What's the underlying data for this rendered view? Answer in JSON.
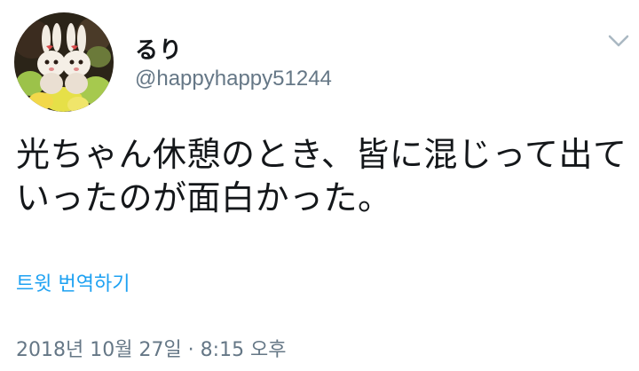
{
  "tweet": {
    "display_name": "るり",
    "handle": "@happyhappy51244",
    "text_line_1": "光ちゃん休憩のとき、皆に混じって出て",
    "text_line_2": "いったのが面白かった。",
    "translate_label": "트윗 번역하기",
    "timestamp": "2018년 10월 27일 · 8:15 오후"
  },
  "icons": {
    "menu": "chevron-down-icon",
    "avatar": "avatar-image"
  },
  "colors": {
    "text": "#14171a",
    "secondary": "#657786",
    "link": "#1da1f2"
  }
}
